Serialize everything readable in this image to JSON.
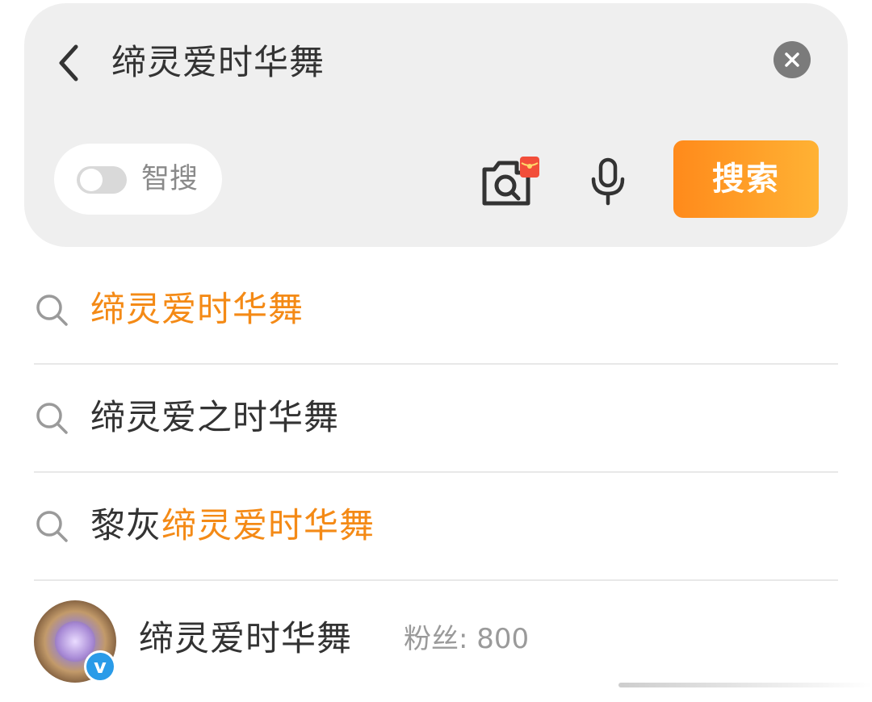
{
  "search": {
    "query": "缔灵爱时华舞",
    "smart_search_label": "智搜",
    "smart_search_enabled": false,
    "search_button_label": "搜索",
    "accent_color": "#f48a16"
  },
  "suggestions": [
    {
      "prefix": "",
      "highlight": "缔灵爱时华舞",
      "suffix": ""
    },
    {
      "prefix": "缔灵爱之时华舞",
      "highlight": "",
      "suffix": ""
    },
    {
      "prefix": "黎灰",
      "highlight": "缔灵爱时华舞",
      "suffix": ""
    }
  ],
  "account": {
    "name": "缔灵爱时华舞",
    "fans_label": "粉丝: 800",
    "verified": true,
    "verified_mark": "v"
  },
  "icons": {
    "back": "chevron-left-icon",
    "clear": "close-circle-icon",
    "camera": "camera-search-icon",
    "mic": "microphone-icon",
    "suggestion": "search-icon"
  }
}
